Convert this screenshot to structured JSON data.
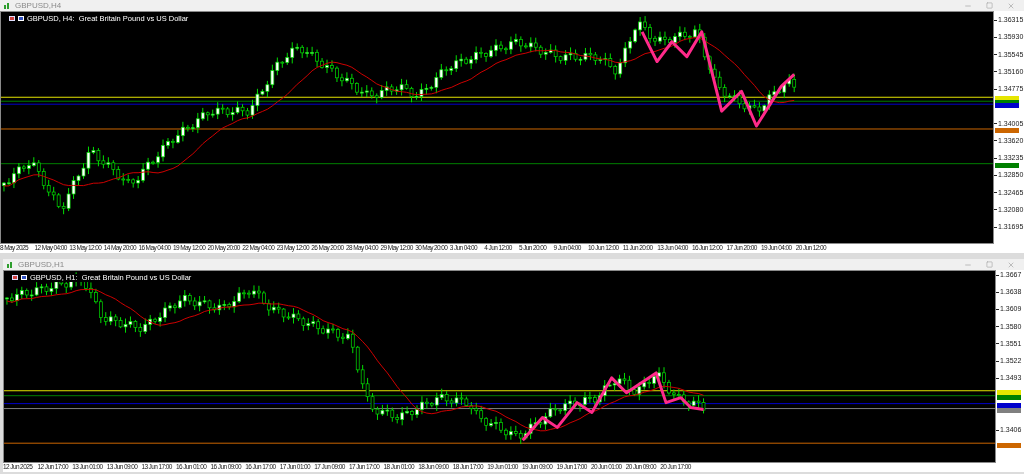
{
  "windows": [
    {
      "title": "GBPUSD,H4",
      "chart_label": "GBPUSD, H4:  Great Britain Pound vs US Dollar",
      "price_axis": [
        "1.36315",
        "1.35930",
        "1.35545",
        "1.35160",
        "1.34775",
        "1.34005",
        "1.33620",
        "1.33235",
        "1.32850",
        "1.32465",
        "1.32080",
        "1.31695"
      ],
      "time_axis": [
        "8 May 2025",
        "12 May 04:00",
        "13 May 12:00",
        "14 May 20:00",
        "16 May 04:00",
        "19 May 12:00",
        "20 May 20:00",
        "22 May 04:00",
        "23 May 12:00",
        "26 May 20:00",
        "28 May 04:00",
        "29 May 12:00",
        "30 May 20:00",
        "3 Jun 04:00",
        "4 Jun 12:00",
        "5 Jun 20:00",
        "9 Jun 04:00",
        "10 Jun 12:00",
        "11 Jun 20:00",
        "13 Jun 04:00",
        "16 Jun 12:00",
        "17 Jun 20:00",
        "19 Jun 04:00",
        "20 Jun 12:00"
      ],
      "levels": [
        {
          "color": "#e6e600"
        },
        {
          "color": "#008000"
        },
        {
          "color": "#0000cc"
        },
        {
          "color": "#cc6600"
        },
        {
          "color": "#008000"
        }
      ]
    },
    {
      "title": "GBPUSD,H1",
      "chart_label": "GBPUSD, H1:  Great Britain Pound vs US Dollar",
      "price_axis": [
        "1.3667",
        "1.3638",
        "1.3609",
        "1.3580",
        "1.3551",
        "1.3522",
        "1.3493",
        "1.3406"
      ],
      "time_axis": [
        "12 Jun 2025",
        "12 Jun 17:00",
        "13 Jun 01:00",
        "13 Jun 09:00",
        "13 Jun 17:00",
        "16 Jun 01:00",
        "16 Jun 09:00",
        "16 Jun 17:00",
        "17 Jun 01:00",
        "17 Jun 09:00",
        "17 Jun 17:00",
        "18 Jun 01:00",
        "18 Jun 09:00",
        "18 Jun 17:00",
        "19 Jun 01:00",
        "19 Jun 09:00",
        "19 Jun 17:00",
        "20 Jun 01:00",
        "20 Jun 09:00",
        "20 Jun 17:00"
      ],
      "levels": [
        {
          "color": "#e6e600"
        },
        {
          "color": "#008000"
        },
        {
          "color": "#0000cc"
        },
        {
          "color": "#808080"
        },
        {
          "color": "#cc6600"
        }
      ]
    }
  ]
}
